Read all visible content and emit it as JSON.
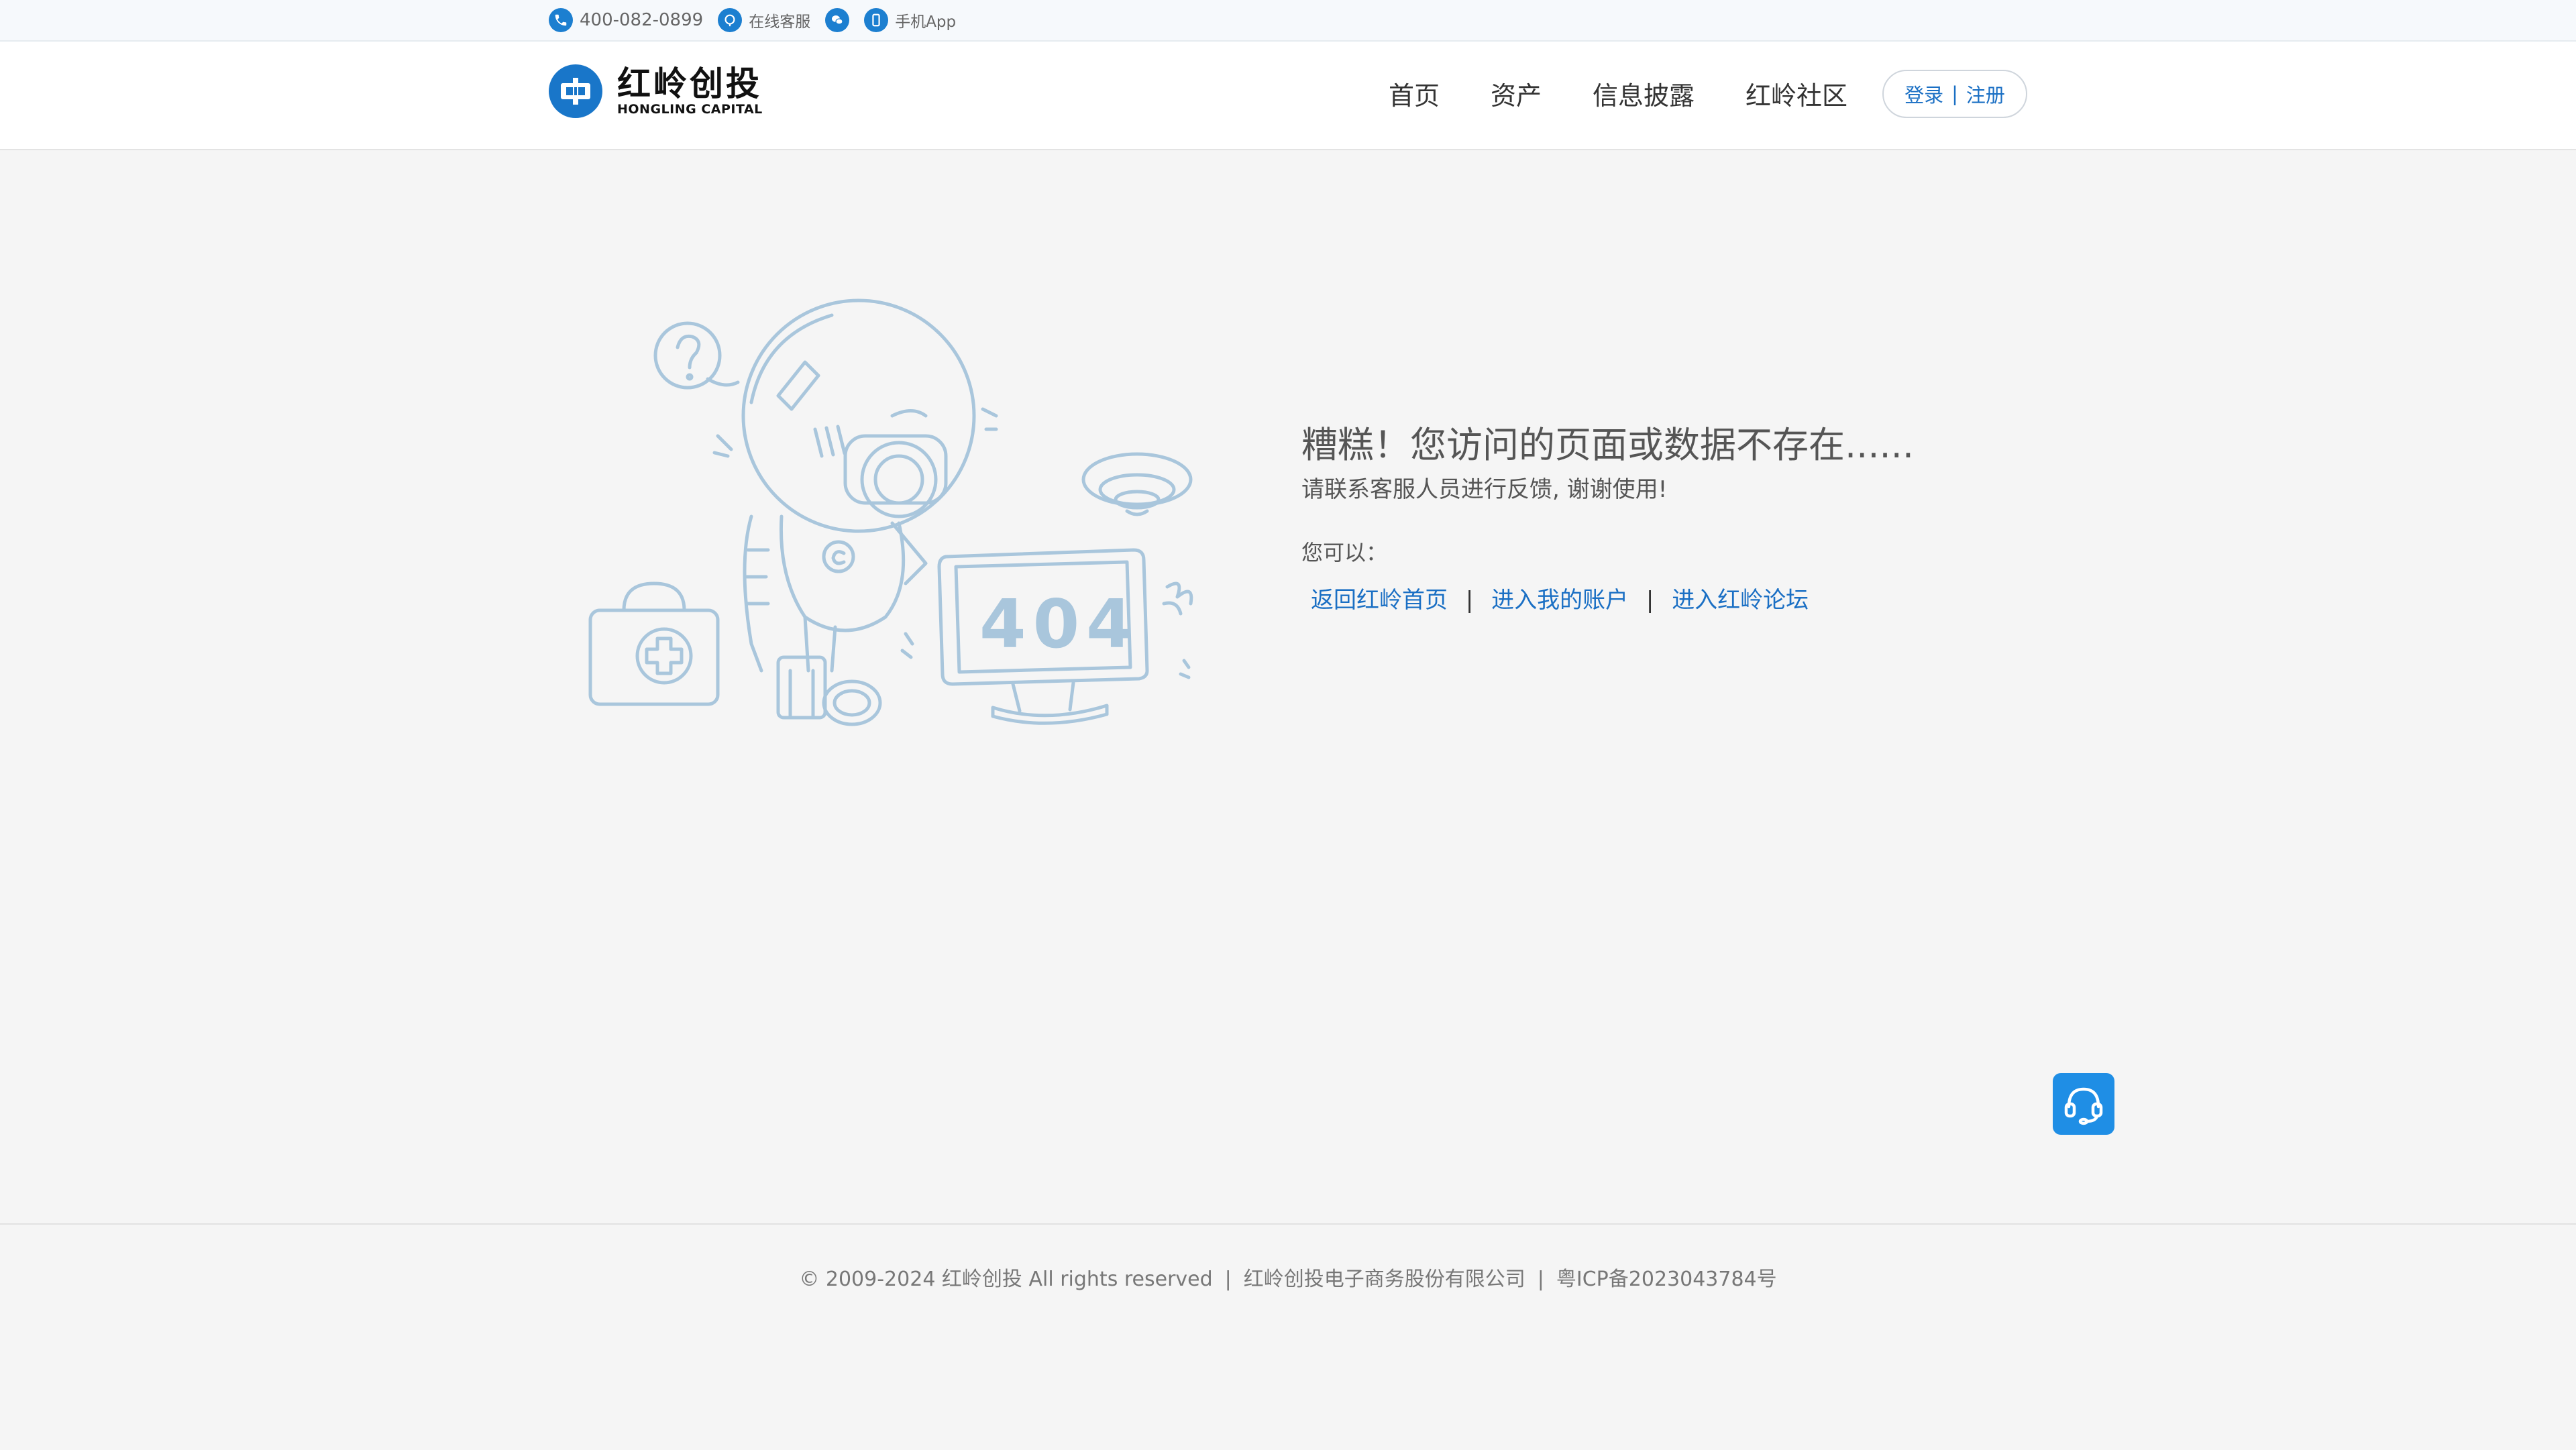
{
  "topbar": {
    "phone": "400-082-0899",
    "online_service": "在线客服",
    "mobile_app": "手机App"
  },
  "header": {
    "logo": {
      "name_cn": "红岭创投",
      "name_en": "HONGLING CAPITAL"
    },
    "nav": [
      {
        "label": "首页"
      },
      {
        "label": "资产"
      },
      {
        "label": "信息披露"
      },
      {
        "label": "红岭社区"
      }
    ],
    "auth": {
      "login": "登录",
      "separator": "|",
      "register": "注册"
    }
  },
  "illustration": {
    "screen_text": "404"
  },
  "error": {
    "title": "糟糕！您访问的页面或数据不存在......",
    "subtitle": "请联系客服人员进行反馈, 谢谢使用!",
    "options_label": "您可以：",
    "links": [
      {
        "label": "返回红岭首页"
      },
      {
        "label": "进入我的账户"
      },
      {
        "label": "进入红岭论坛"
      }
    ],
    "link_separator": "|"
  },
  "footer": {
    "copyright": "© 2009-2024 红岭创投 All rights reserved",
    "company": "红岭创投电子商务股份有限公司",
    "icp": "粤ICP备2023043784号",
    "separator": "|"
  },
  "colors": {
    "brand_blue": "#1976c9",
    "link_blue": "#1a6fc4",
    "illustration_stroke": "#a9c6dc",
    "background": "#f5f5f5"
  },
  "icons": {
    "phone": "phone-icon",
    "online_service": "chat-bubble-icon",
    "wechat": "wechat-icon",
    "mobile": "mobile-phone-icon",
    "float_service": "headset-icon"
  }
}
